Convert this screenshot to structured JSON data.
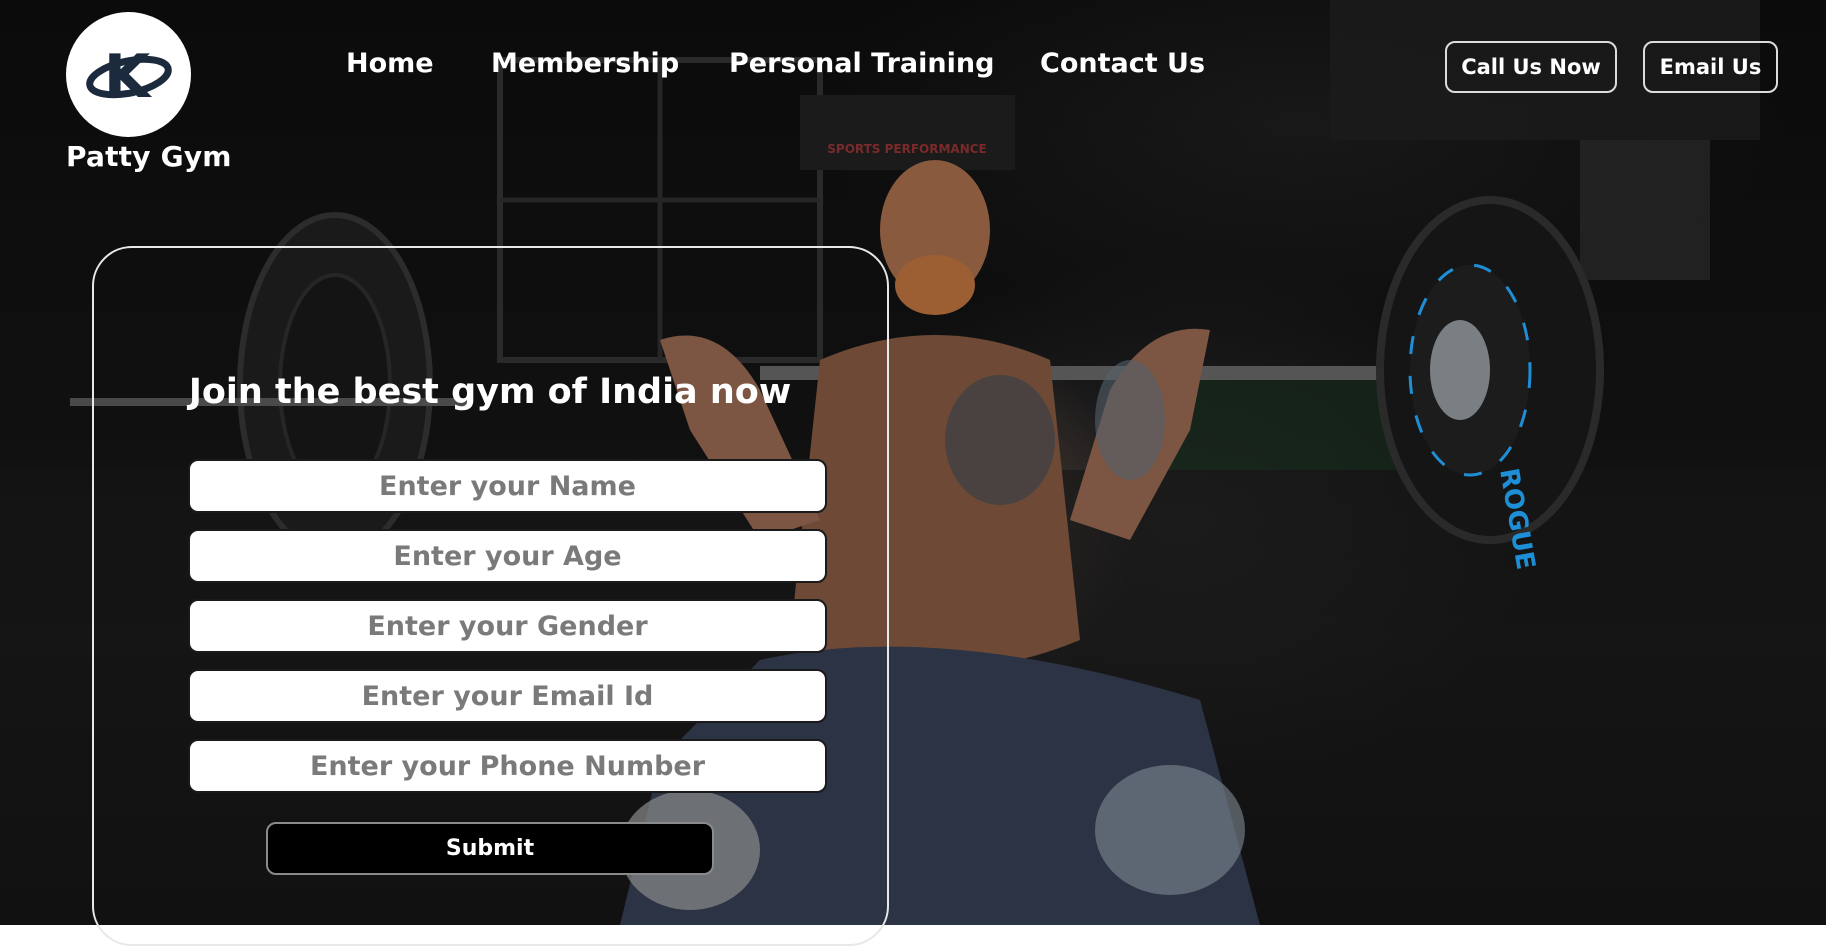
{
  "brand": {
    "name": "Patty Gym",
    "logo_letter": "K",
    "logo_icon": "k-swoosh-logo-icon"
  },
  "nav": {
    "items": [
      {
        "label": "Home"
      },
      {
        "label": "Membership"
      },
      {
        "label": "Personal Training"
      },
      {
        "label": "Contact Us"
      }
    ],
    "call_button": "Call Us Now",
    "email_button": "Email Us"
  },
  "hero": {
    "background": "gym-weightlifter-photo",
    "poster_text": "SPORTS PERFORMANCE",
    "plate_text": "ROGUE"
  },
  "form": {
    "title": "Join the best gym of India now",
    "fields": [
      {
        "placeholder": "Enter your Name"
      },
      {
        "placeholder": "Enter your Age"
      },
      {
        "placeholder": "Enter your Gender"
      },
      {
        "placeholder": "Enter your Email Id"
      },
      {
        "placeholder": "Enter your Phone Number"
      }
    ],
    "submit_label": "Submit"
  },
  "colors": {
    "background": "#0b0b0b",
    "text": "#ffffff",
    "input_bg": "#ffffff",
    "placeholder": "#7a7a7a",
    "submit_bg": "#000000",
    "plate_accent": "#1e8fd6"
  }
}
